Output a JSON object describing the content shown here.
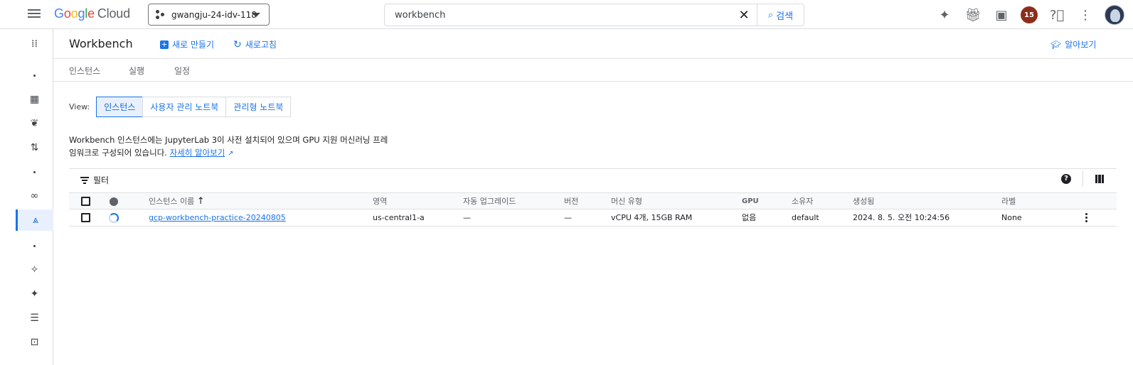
{
  "topbar": {
    "logo_google": [
      "G",
      "o",
      "o",
      "g",
      "l",
      "e"
    ],
    "logo_cloud": "Cloud",
    "project": "gwangju-24-idv-118",
    "search_value": "workbench",
    "search_button": "검색",
    "notification_count": "15"
  },
  "header": {
    "title": "Workbench",
    "create_label": "새로 만들기",
    "refresh_label": "새로고침",
    "learn_label": "알아보기"
  },
  "tabs": [
    "인스턴스",
    "실행",
    "일정"
  ],
  "view": {
    "label": "View:",
    "options": [
      "인스턴스",
      "사용자 관리 노트북",
      "관리형 노트북"
    ],
    "selected": "인스턴스"
  },
  "description": {
    "line1": "Workbench 인스턴스에는 JupyterLab 3이 사전 설치되어 있으며 GPU 지원 머신러닝 프레",
    "line2": "임워크로 구성되어 있습니다.",
    "link": "자세히 알아보기"
  },
  "filter": {
    "label": "필터"
  },
  "table": {
    "headers": {
      "name": "인스턴스 이름",
      "zone": "영역",
      "auto_upgrade": "자동 업그레이드",
      "version": "버전",
      "machine_type": "머신 유형",
      "gpu": "GPU",
      "owner": "소유자",
      "created": "생성됨",
      "labels": "라벨"
    },
    "rows": [
      {
        "name": "gcp-workbench-practice-20240805",
        "zone": "us-central1-a",
        "auto_upgrade": "—",
        "version": "—",
        "machine_type": "vCPU 4개, 15GB RAM",
        "gpu": "없음",
        "owner": "default",
        "created": "2024. 8. 5. 오전 10:24:56",
        "labels": "None"
      }
    ]
  },
  "colors": {
    "accent": "#1a73e8",
    "badge": "#8c2e1d"
  }
}
